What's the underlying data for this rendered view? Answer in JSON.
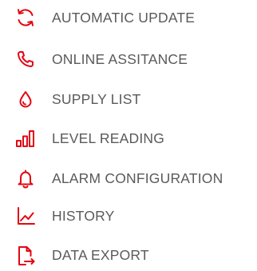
{
  "accent_color": "#E30613",
  "label_color": "#5a5a5a",
  "menu": {
    "items": [
      {
        "icon": "refresh-icon",
        "label": "AUTOMATIC UPDATE"
      },
      {
        "icon": "phone-icon",
        "label": "ONLINE ASSITANCE"
      },
      {
        "icon": "drop-icon",
        "label": "SUPPLY LIST"
      },
      {
        "icon": "bar-chart-icon",
        "label": "LEVEL READING"
      },
      {
        "icon": "bell-icon",
        "label": "ALARM CONFIGURATION"
      },
      {
        "icon": "line-chart-icon",
        "label": "HISTORY"
      },
      {
        "icon": "file-export-icon",
        "label": "DATA EXPORT"
      }
    ]
  }
}
